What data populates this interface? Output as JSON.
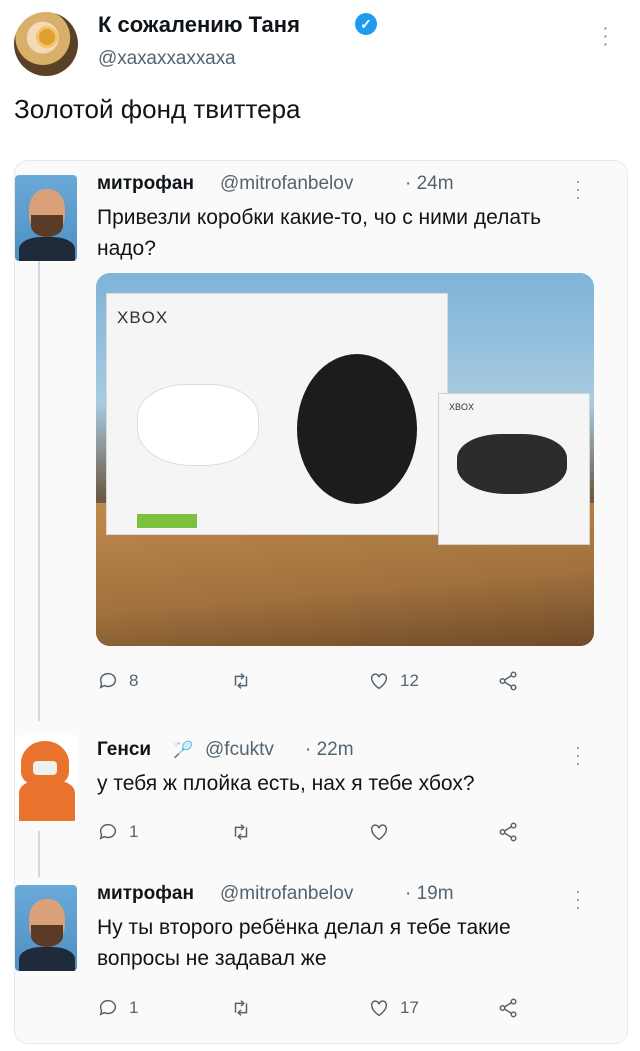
{
  "author": {
    "name": "К сожалению Таня",
    "handle": "@хахаххаххаха",
    "verified": true
  },
  "tweet_text": "Золотой фонд твиттера",
  "colors": {
    "verified": "#1d9bf0",
    "secondary_text": "#536471",
    "thread_line": "#cfd9de"
  },
  "replies": [
    {
      "name": "митрофан",
      "handle": "@mitrofanbelov",
      "time": "· 24m",
      "text": "Привезли коробки какие-то, чо с ними делать надо?",
      "has_photo": true,
      "photo_labels": {
        "box_logo": "XBOX",
        "box2_logo": "XBOX"
      },
      "stats": {
        "comments": "8",
        "retweets": "",
        "likes": "12"
      }
    },
    {
      "name": "Генси",
      "name_icon": "badminton-icon",
      "handle": "@fcuktv",
      "time": "· 22m",
      "text": "у тебя ж плойка есть, нах  я тебе хбох?",
      "stats": {
        "comments": "1",
        "retweets": "",
        "likes": ""
      }
    },
    {
      "name": "митрофан",
      "handle": "@mitrofanbelov",
      "time": "· 19m",
      "text": "Ну ты второго ребёнка делал я тебе такие вопросы не задавал же",
      "stats": {
        "comments": "1",
        "retweets": "",
        "likes": "17"
      }
    }
  ],
  "icons": {
    "more": "more-vertical-icon",
    "comment": "comment-icon",
    "retweet": "retweet-icon",
    "like": "heart-icon",
    "share": "share-icon"
  }
}
